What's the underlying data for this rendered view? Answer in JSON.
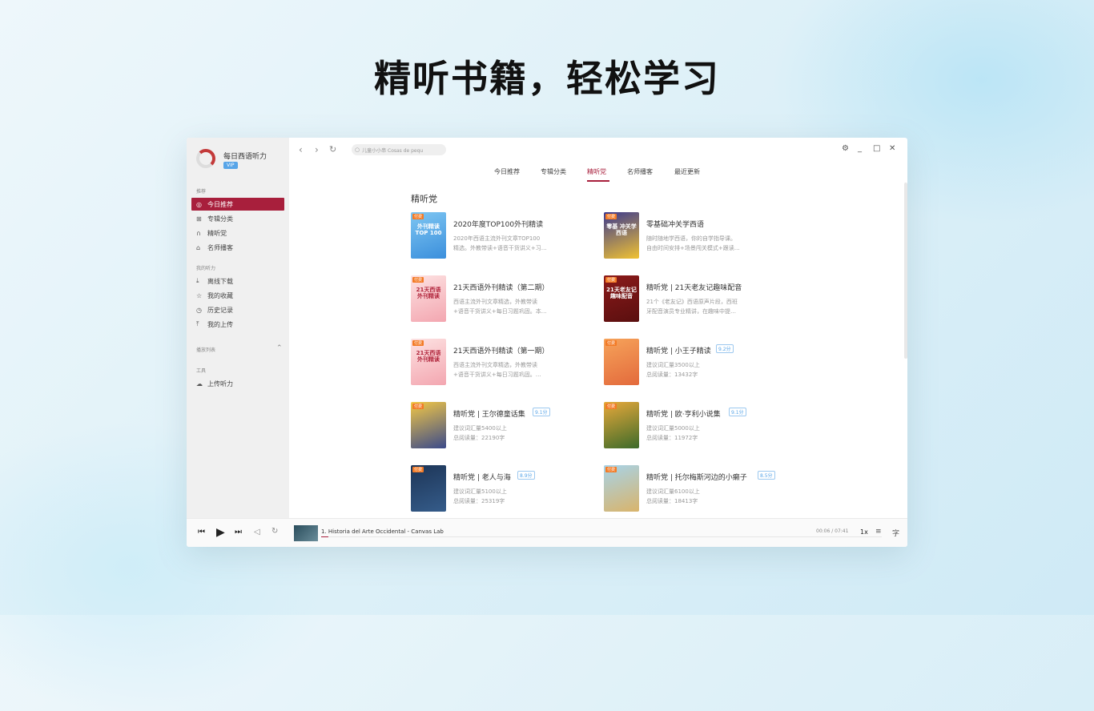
{
  "headline": "精听书籍，轻松学习",
  "app": {
    "name": "每日西语听力",
    "vip": "VIP"
  },
  "sidebar": {
    "sec_recommend": "推荐",
    "sec_my": "我的听力",
    "sec_playlist": "播放列表",
    "sec_tools": "工具",
    "items": [
      {
        "label": "今日推荐",
        "icon": "compass-icon"
      },
      {
        "label": "专辑分类",
        "icon": "grid-icon"
      },
      {
        "label": "精听党",
        "icon": "headphones-icon"
      },
      {
        "label": "名师播客",
        "icon": "graduation-cap-icon"
      },
      {
        "label": "离线下载",
        "icon": "download-icon"
      },
      {
        "label": "我的收藏",
        "icon": "star-icon"
      },
      {
        "label": "历史记录",
        "icon": "clock-icon"
      },
      {
        "label": "我的上传",
        "icon": "upload-icon"
      },
      {
        "label": "上传听力",
        "icon": "cloud-upload-icon"
      }
    ]
  },
  "search": {
    "placeholder": "儿童小小串 Cosas de pequ"
  },
  "tabs": [
    "今日推荐",
    "专辑分类",
    "精听党",
    "名师播客",
    "最近更新"
  ],
  "section_title": "精听党",
  "cards": [
    {
      "title": "2020年度TOP100外刊精读",
      "tag": "付费",
      "cover_text": "外刊精读 TOP 100",
      "line1": "2020年西语主流外刊文章TOP100",
      "line2": "精选。外教带读+语音干货讲义+习…"
    },
    {
      "title": "零基础冲关学西语",
      "tag": "付费",
      "cover_text": "零基 冲关学西语",
      "line1": "随时随地学西语，你的自学指导课。",
      "line2": "自由时间安排+场景闯关模式+跟读…"
    },
    {
      "title": "21天西语外刊精读（第二期）",
      "tag": "付费",
      "cover_text": "21天西语 外刊精读",
      "line1": "西语主流外刊文章精选，外教带读",
      "line2": "+语音干货讲义+每日习题巩固。本…"
    },
    {
      "title": "精听党 | 21天老友记趣味配音",
      "tag": "付费",
      "cover_text": "21天老友记 趣味配音",
      "line1": "21个《老友记》西语原声片段，西班",
      "line2": "牙配音演员专业精讲，在趣味中提…"
    },
    {
      "title": "21天西语外刊精读（第一期）",
      "tag": "付费",
      "cover_text": "21天西语 外刊精读",
      "line1": "西语主流外刊文章精选，外教带读",
      "line2": "+语音干货讲义+每日习题巩固。…"
    },
    {
      "title": "精听党 | 小王子精读",
      "tag": "付费",
      "score": "9.2分",
      "cover_text": "",
      "line1": "建议词汇量3500以上",
      "line2": "总阅读量：13432字"
    },
    {
      "title": "精听党 | 王尔德童话集",
      "tag": "付费",
      "score": "9.1分",
      "cover_text": "",
      "line1": "建议词汇量5400以上",
      "line2": "总阅读量：22190字"
    },
    {
      "title": "精听党 | 欧·亨利小说集",
      "tag": "付费",
      "score": "9.1分",
      "cover_text": "",
      "line1": "建议词汇量5000以上",
      "line2": "总阅读量：11972字"
    },
    {
      "title": "精听党 | 老人与海",
      "tag": "付费",
      "score": "8.9分",
      "cover_text": "",
      "line1": "建议词汇量5100以上",
      "line2": "总阅读量：25319字"
    },
    {
      "title": "精听党 | 托尔梅斯河边的小癞子",
      "tag": "付费",
      "score": "8.5分",
      "cover_text": "",
      "line1": "建议词汇量6100以上",
      "line2": "总阅读量：18413字"
    }
  ],
  "player": {
    "track": "1. Historia del Arte Occidental - Canvas Lab",
    "time": "00:06 / 07:41",
    "speed": "1x",
    "text_mode": "字",
    "progress": 0.013
  },
  "colors": {
    "accent": "#a81f3c",
    "score_blue": "#58a5e8",
    "tag_orange": "#f37a25"
  }
}
